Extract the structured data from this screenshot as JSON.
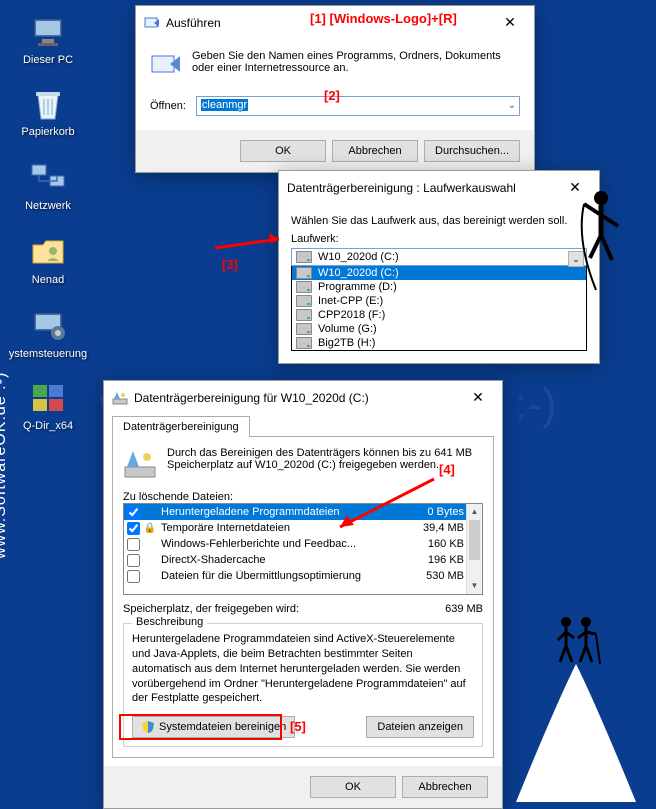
{
  "desktop": {
    "icons": [
      {
        "label": "Dieser PC"
      },
      {
        "label": "Papierkorb"
      },
      {
        "label": "Netzwerk"
      },
      {
        "label": "Nenad"
      },
      {
        "label": "ystemsteuerung"
      },
      {
        "label": "Q-Dir_x64"
      }
    ]
  },
  "run": {
    "title": "Ausführen",
    "message": "Geben Sie den Namen eines Programms, Ordners, Dokuments oder einer Internetressource an.",
    "open_label": "Öffnen:",
    "command": "cleanmgr",
    "ok": "OK",
    "cancel": "Abbrechen",
    "browse": "Durchsuchen..."
  },
  "drive": {
    "title": "Datenträgerbereinigung : Laufwerkauswahl",
    "message": "Wählen Sie das Laufwerk aus, das bereinigt werden soll.",
    "label": "Laufwerk:",
    "selected": "W10_2020d (C:)",
    "options": [
      "W10_2020d (C:)",
      "Programme (D:)",
      "Inet-CPP (E:)",
      "CPP2018 (F:)",
      "Volume (G:)",
      "Big2TB (H:)"
    ]
  },
  "cleanup": {
    "title": "Datenträgerbereinigung für W10_2020d (C:)",
    "tab": "Datenträgerbereinigung",
    "info": "Durch das Bereinigen des Datenträgers können bis zu 641 MB Speicherplatz auf W10_2020d (C:) freigegeben werden.",
    "delete_label": "Zu löschende Dateien:",
    "files": [
      {
        "checked": true,
        "locked": false,
        "name": "Heruntergeladene Programmdateien",
        "size": "0 Bytes",
        "selected": true
      },
      {
        "checked": true,
        "locked": true,
        "name": "Temporäre Internetdateien",
        "size": "39,4 MB",
        "selected": false
      },
      {
        "checked": false,
        "locked": false,
        "name": "Windows-Fehlerberichte und Feedbac...",
        "size": "160 KB",
        "selected": false
      },
      {
        "checked": false,
        "locked": false,
        "name": "DirectX-Shadercache",
        "size": "196 KB",
        "selected": false
      },
      {
        "checked": false,
        "locked": false,
        "name": "Dateien für die Übermittlungsoptimierung",
        "size": "530 MB",
        "selected": false
      }
    ],
    "space_label": "Speicherplatz, der freigegeben wird:",
    "space_value": "639 MB",
    "desc_legend": "Beschreibung",
    "desc_text": "Heruntergeladene Programmdateien sind ActiveX-Steuerelemente und Java-Applets, die beim Betrachten bestimmter Seiten automatisch aus dem Internet heruntergeladen werden. Sie werden vorübergehend im Ordner \"Heruntergeladene Programmdateien\" auf der Festplatte gespeichert.",
    "sys_clean": "Systemdateien bereinigen",
    "view_files": "Dateien anzeigen",
    "ok": "OK",
    "cancel": "Abbrechen"
  },
  "annotations": {
    "a1": "[1]  [Windows-Logo]+[R]",
    "a2": "[2]",
    "a3": "[3]",
    "a4": "[4]",
    "a5": "[5]"
  },
  "watermark": "www.SoftwareOK.de  :-)"
}
